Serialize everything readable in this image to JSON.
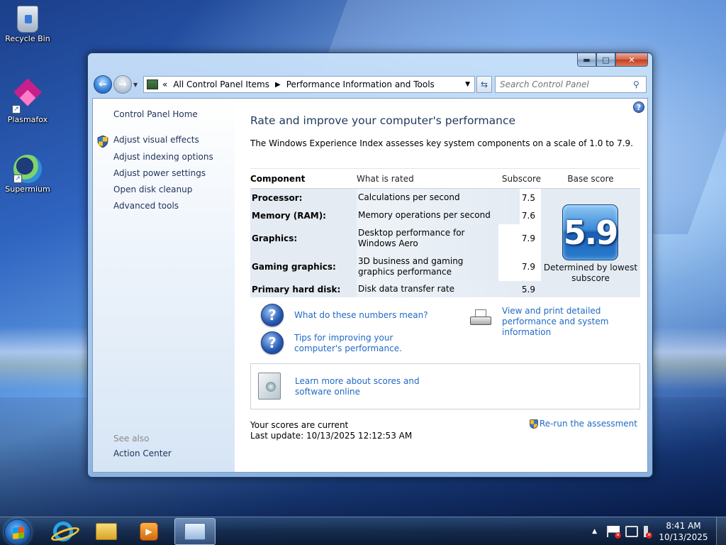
{
  "desktop": {
    "icons": [
      {
        "label": "Recycle Bin"
      },
      {
        "label": "Plasmafox"
      },
      {
        "label": "Supermium"
      }
    ]
  },
  "window": {
    "controls": {
      "minimize": "▬",
      "maximize": "□",
      "close": "✕"
    },
    "navbar": {
      "back_glyph": "←",
      "forward_glyph": "→",
      "breadcrumb_root_glyph": "«",
      "crumbs": [
        "All Control Panel Items",
        "Performance Information and Tools"
      ],
      "crumb_sep": "▶",
      "search_placeholder": "Search Control Panel"
    },
    "sidebar": {
      "home": "Control Panel Home",
      "links": [
        "Adjust visual effects",
        "Adjust indexing options",
        "Adjust power settings",
        "Open disk cleanup",
        "Advanced tools"
      ],
      "see_also_label": "See also",
      "see_also_links": [
        "Action Center"
      ]
    },
    "main": {
      "help_glyph": "?",
      "title": "Rate and improve your computer's performance",
      "description": "The Windows Experience Index assesses key system components on a scale of 1.0 to 7.9.",
      "table": {
        "headers": {
          "component": "Component",
          "what": "What is rated",
          "subscore": "Subscore",
          "base": "Base score"
        },
        "rows": [
          {
            "component": "Processor:",
            "what": "Calculations per second",
            "subscore": "7.5"
          },
          {
            "component": "Memory (RAM):",
            "what": "Memory operations per second",
            "subscore": "7.6"
          },
          {
            "component": "Graphics:",
            "what": "Desktop performance for Windows Aero",
            "subscore": "7.9"
          },
          {
            "component": "Gaming graphics:",
            "what": "3D business and gaming graphics performance",
            "subscore": "7.9"
          },
          {
            "component": "Primary hard disk:",
            "what": "Disk data transfer rate",
            "subscore": "5.9"
          }
        ],
        "base_score": "5.9",
        "base_caption": "Determined by lowest subscore"
      },
      "links": {
        "numbers_meaning": "What do these numbers mean?",
        "tips": "Tips for improving your computer's performance.",
        "print": "View and print detailed performance and system information",
        "learn_more": "Learn more about scores and software online"
      },
      "status": {
        "current": "Your scores are current",
        "last_update": "Last update: 10/13/2025 12:12:53 AM"
      },
      "rerun": "Re-run the assessment"
    }
  },
  "taskbar": {
    "clock_time": "8:41 AM",
    "clock_date": "10/13/2025",
    "tray_arrow": "▲"
  }
}
